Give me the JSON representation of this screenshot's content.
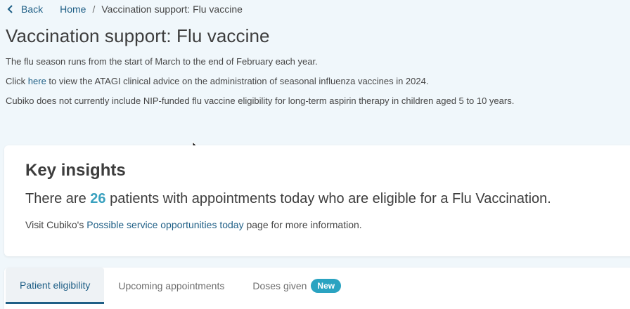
{
  "breadcrumb": {
    "back_label": "Back",
    "home_label": "Home",
    "separator": "/",
    "current": "Vaccination support: Flu vaccine"
  },
  "page": {
    "title": "Vaccination support: Flu vaccine",
    "line1": "The flu season runs from the start of March to the end of February each year.",
    "line2_prefix": "Click ",
    "line2_link": "here",
    "line2_suffix": " to view the ATAGI clinical advice on the administration of seasonal influenza vaccines in 2024.",
    "line3": "Cubiko does not currently include NIP-funded flu vaccine eligibility for long-term aspirin therapy in children aged 5 to 10 years."
  },
  "insights": {
    "title": "Key insights",
    "text_prefix": "There are ",
    "count": "26",
    "text_suffix": " patients with appointments today who are eligible for a Flu Vaccination.",
    "note_prefix": "Visit Cubiko's ",
    "note_link": "Possible service opportunities today",
    "note_suffix": " page for more information."
  },
  "tabs": [
    {
      "label": "Patient eligibility",
      "active": true
    },
    {
      "label": "Upcoming appointments",
      "active": false
    },
    {
      "label": "Doses given",
      "active": false,
      "badge": "New"
    }
  ],
  "colors": {
    "link": "#1f5f86",
    "accent": "#3aa1bf",
    "badge": "#2aa3c1",
    "background": "#f0f7fb"
  }
}
